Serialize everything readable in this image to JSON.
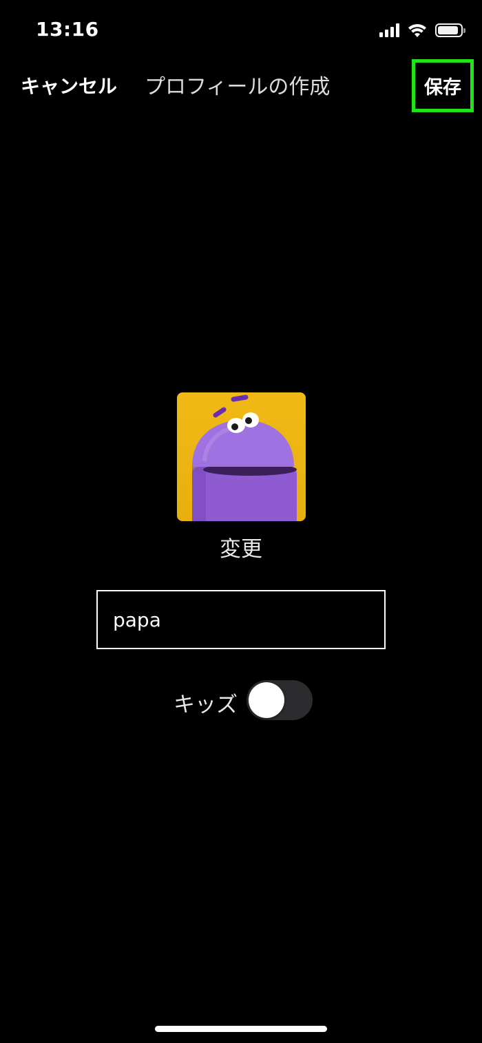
{
  "status_bar": {
    "time": "13:16",
    "icons": [
      "cellular-signal-icon",
      "wifi-icon",
      "battery-icon"
    ],
    "battery_level": 0.9
  },
  "nav": {
    "cancel_label": "キャンセル",
    "title": "プロフィールの作成",
    "save_label": "保存",
    "save_highlight_color": "#22e31a"
  },
  "profile": {
    "avatar": "purple-robot-character-avatar",
    "avatar_background": "#f1b915",
    "change_label": "変更",
    "name_value": "papa",
    "kids_label": "キッズ",
    "kids_enabled": false
  }
}
